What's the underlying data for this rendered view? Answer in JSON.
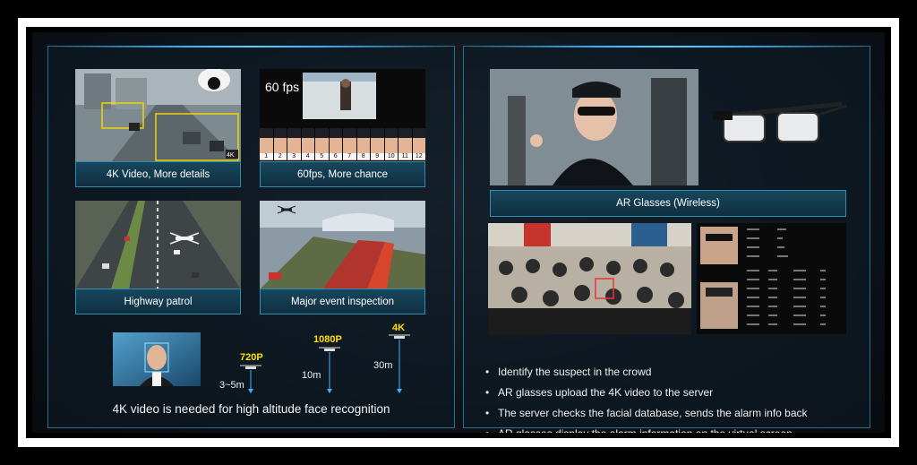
{
  "left_panel": {
    "tiles": [
      {
        "caption": "4K Video, More details",
        "badge": "4K"
      },
      {
        "caption": "60fps, More chance",
        "overlay": "60 fps",
        "frame_numbers": [
          "1",
          "2",
          "3",
          "4",
          "5",
          "6",
          "7",
          "8",
          "9",
          "10",
          "11",
          "12"
        ]
      },
      {
        "caption": "Highway patrol"
      },
      {
        "caption": "Major event inspection"
      }
    ],
    "resolutions": [
      {
        "label": "720P",
        "altitude": "3~5m"
      },
      {
        "label": "1080P",
        "altitude": "10m"
      },
      {
        "label": "4K",
        "altitude": "30m"
      }
    ],
    "footer": "4K video is needed for high altitude face recognition"
  },
  "right_panel": {
    "glasses_caption": "AR Glasses (Wireless)",
    "bullets": [
      "Identify the suspect in the crowd",
      "AR glasses upload the 4K video to the server",
      "The server checks the facial database, sends the alarm info back",
      "AR glasses display the alarm information on the virtual screen"
    ]
  },
  "colors": {
    "accent": "#36b6ff",
    "caption_border": "#2e8fb4",
    "resolution_label": "#ffe000"
  }
}
